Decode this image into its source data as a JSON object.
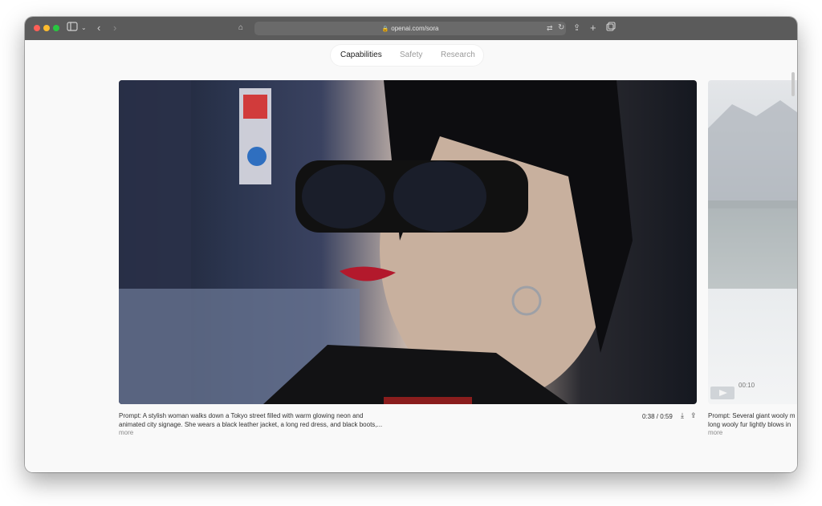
{
  "browser": {
    "url": "openai.com/sora"
  },
  "nav": {
    "tabs": [
      {
        "label": "Capabilities"
      },
      {
        "label": "Safety"
      },
      {
        "label": "Research"
      }
    ]
  },
  "videos": [
    {
      "prompt_line1": "Prompt: A stylish woman walks down a Tokyo street filled with warm glowing neon and",
      "prompt_line2": "animated city signage. She wears a black leather jacket, a long red dress, and black boots,...",
      "more_label": "more",
      "time": "0:38 / 0:59"
    },
    {
      "prompt_line1": "Prompt: Several giant wooly m",
      "prompt_line2": "long wooly fur lightly blows in",
      "more_label": "more",
      "time": "00:10"
    }
  ],
  "colors": {
    "titlebar": "#5b5b5b",
    "page_background": "#f9f9f9"
  }
}
